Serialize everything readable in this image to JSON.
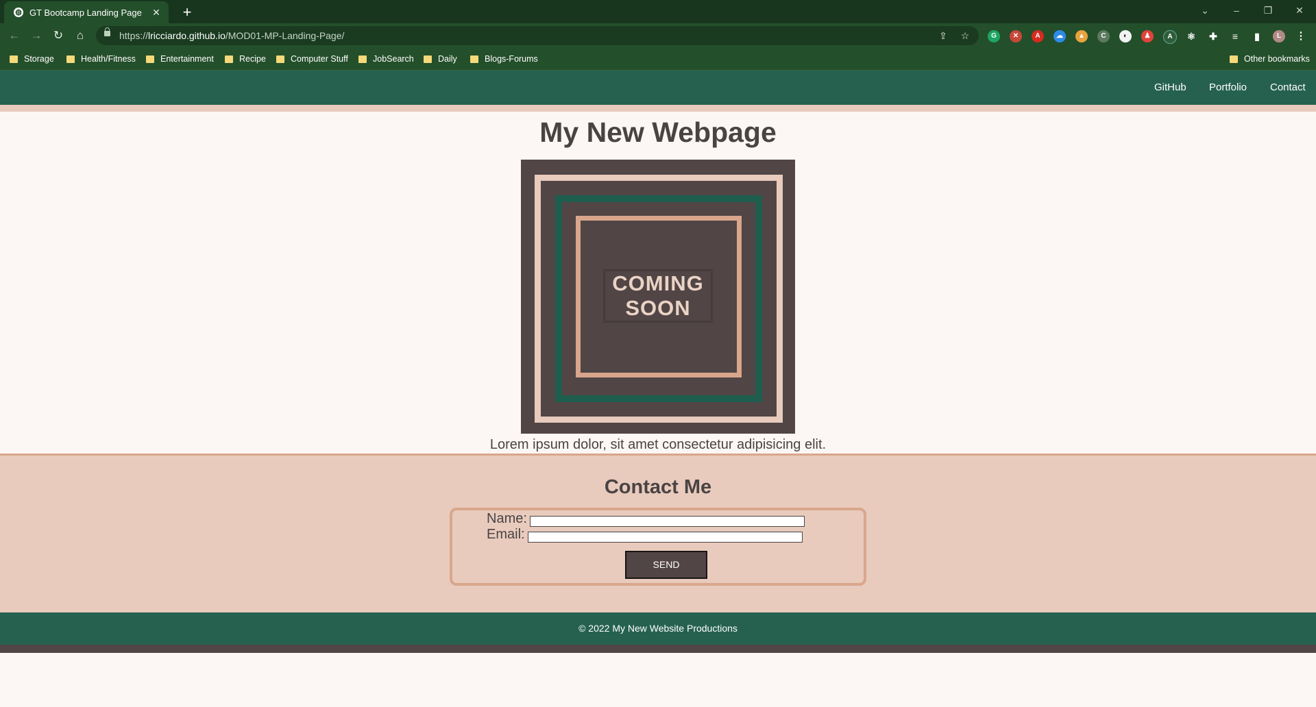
{
  "browser": {
    "tab_title": "GT Bootcamp Landing Page",
    "url_prefix": "https://",
    "url_host": "lricciardo.github.io",
    "url_path": "/MOD01-MP-Landing-Page/",
    "profile_initial": "L",
    "bookmarks": [
      "Storage",
      "Health/Fitness",
      "Entertainment",
      "Recipe",
      "Computer Stuff",
      "JobSearch",
      "Daily",
      "Blogs-Forums"
    ],
    "other_bookmarks": "Other bookmarks"
  },
  "site": {
    "nav": [
      "GitHub",
      "Portfolio",
      "Contact"
    ],
    "title": "My New Webpage",
    "banner_line1": "COMING",
    "banner_line2": "SOON",
    "lorem": "Lorem ipsum dolor, sit amet consectetur adipisicing elit.",
    "contact_heading": "Contact Me",
    "name_label": "Name:",
    "email_label": "Email:",
    "send_label": "SEND",
    "footer": "© 2022 My New Website Productions"
  },
  "colors": {
    "header_green": "#266150",
    "accent_peach": "#e8cbbd",
    "dark_brown": "#514545",
    "page_bg": "#fcf7f4"
  }
}
